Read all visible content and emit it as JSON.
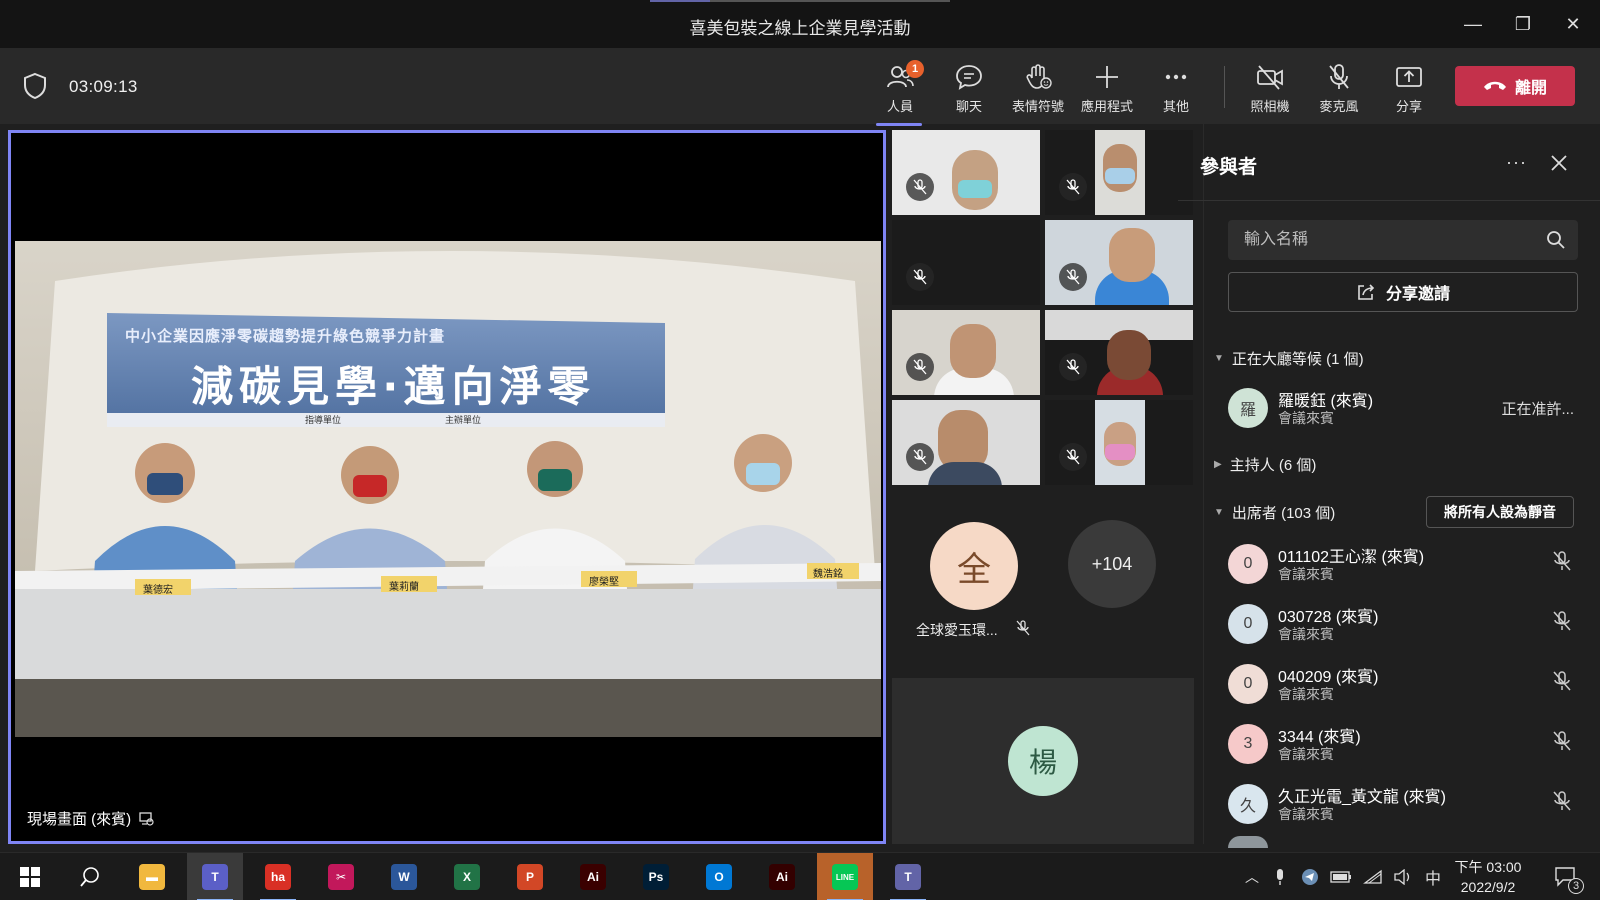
{
  "window": {
    "title": "喜美包裝之線上企業見學活動",
    "minimize": "—",
    "maximize": "❐",
    "close": "✕"
  },
  "toolbar": {
    "timer": "03:09:13",
    "buttons": [
      {
        "label": "人員",
        "icon": "people-icon",
        "badge": "1"
      },
      {
        "label": "聊天",
        "icon": "chat-icon"
      },
      {
        "label": "表情符號",
        "icon": "raise-hand-icon"
      },
      {
        "label": "應用程式",
        "icon": "plus-icon"
      },
      {
        "label": "其他",
        "icon": "more-icon"
      },
      {
        "label": "照相機",
        "icon": "camera-off-icon"
      },
      {
        "label": "麥克風",
        "icon": "mic-off-icon"
      },
      {
        "label": "分享",
        "icon": "share-icon"
      }
    ],
    "leave_label": "離開"
  },
  "main_video": {
    "caption": "現場畫面 (來賓)",
    "banner_top": "中小企業因應淨零碳趨勢提升綠色競爭力計畫",
    "banner_main": "減碳見學‧邁向淨零",
    "banner_sponsor1": "指導單位",
    "banner_sponsor2": "主辦單位",
    "nameplates": [
      "葉德宏",
      "葉莉蘭",
      "廖榮堅",
      "魏浩銘"
    ]
  },
  "gallery": {
    "avatar_initial": "全",
    "avatar_name": "全球愛玉環...",
    "overflow_count": "+104",
    "bottom_avatar": "楊"
  },
  "panel": {
    "title": "參與者",
    "more": "···",
    "search_placeholder": "輸入名稱",
    "share_invite": "分享邀請",
    "lobby": {
      "header": "正在大廳等候 (1 個)",
      "person": {
        "initial": "羅",
        "name": "羅暖鈺 (來賓)",
        "role": "會議來賓",
        "status": "正在准許..."
      }
    },
    "hosts_header": "主持人 (6 個)",
    "attendees_header": "出席者 (103 個)",
    "mute_all": "將所有人設為靜音",
    "attendees": [
      {
        "initial": "0",
        "name": "011102王心潔 (來賓)",
        "role": "會議來賓",
        "color": "#f3d6d6"
      },
      {
        "initial": "0",
        "name": "030728 (來賓)",
        "role": "會議來賓",
        "color": "#d6e2ea"
      },
      {
        "initial": "0",
        "name": "040209 (來賓)",
        "role": "會議來賓",
        "color": "#f0ddd6"
      },
      {
        "initial": "3",
        "name": "3344 (來賓)",
        "role": "會議來賓",
        "color": "#f6c9c9"
      },
      {
        "initial": "久",
        "name": "久正光電_黃文龍 (來賓)",
        "role": "會議來賓",
        "color": "#d9e6ee"
      }
    ]
  },
  "taskbar": {
    "apps": [
      {
        "name": "explorer",
        "text": "▬",
        "color": "#f1b83e"
      },
      {
        "name": "teams",
        "text": "T",
        "color": "#5b5fc7"
      },
      {
        "name": "chrome",
        "text": "ha",
        "color": "#d93025"
      },
      {
        "name": "snip",
        "text": "✂",
        "color": "#c2185b"
      },
      {
        "name": "word",
        "text": "W",
        "color": "#2b579a"
      },
      {
        "name": "excel",
        "text": "X",
        "color": "#217346"
      },
      {
        "name": "powerpoint",
        "text": "P",
        "color": "#d24726"
      },
      {
        "name": "acrobat",
        "text": "Ai",
        "color": "#3a0000"
      },
      {
        "name": "photoshop",
        "text": "Ps",
        "color": "#001e36"
      },
      {
        "name": "outlook",
        "text": "O",
        "color": "#0078d4"
      },
      {
        "name": "illustrator",
        "text": "Ai",
        "color": "#330000"
      },
      {
        "name": "line",
        "text": "LINE",
        "color": "#06c755"
      },
      {
        "name": "teams-2",
        "text": "T",
        "color": "#6264a7"
      }
    ],
    "ime": "中",
    "time": "下午 03:00",
    "date": "2022/9/2",
    "notifications": "3"
  },
  "colors": {
    "accent": "#7f85f5",
    "leave": "#c4314b",
    "badge": "#e8612c"
  }
}
